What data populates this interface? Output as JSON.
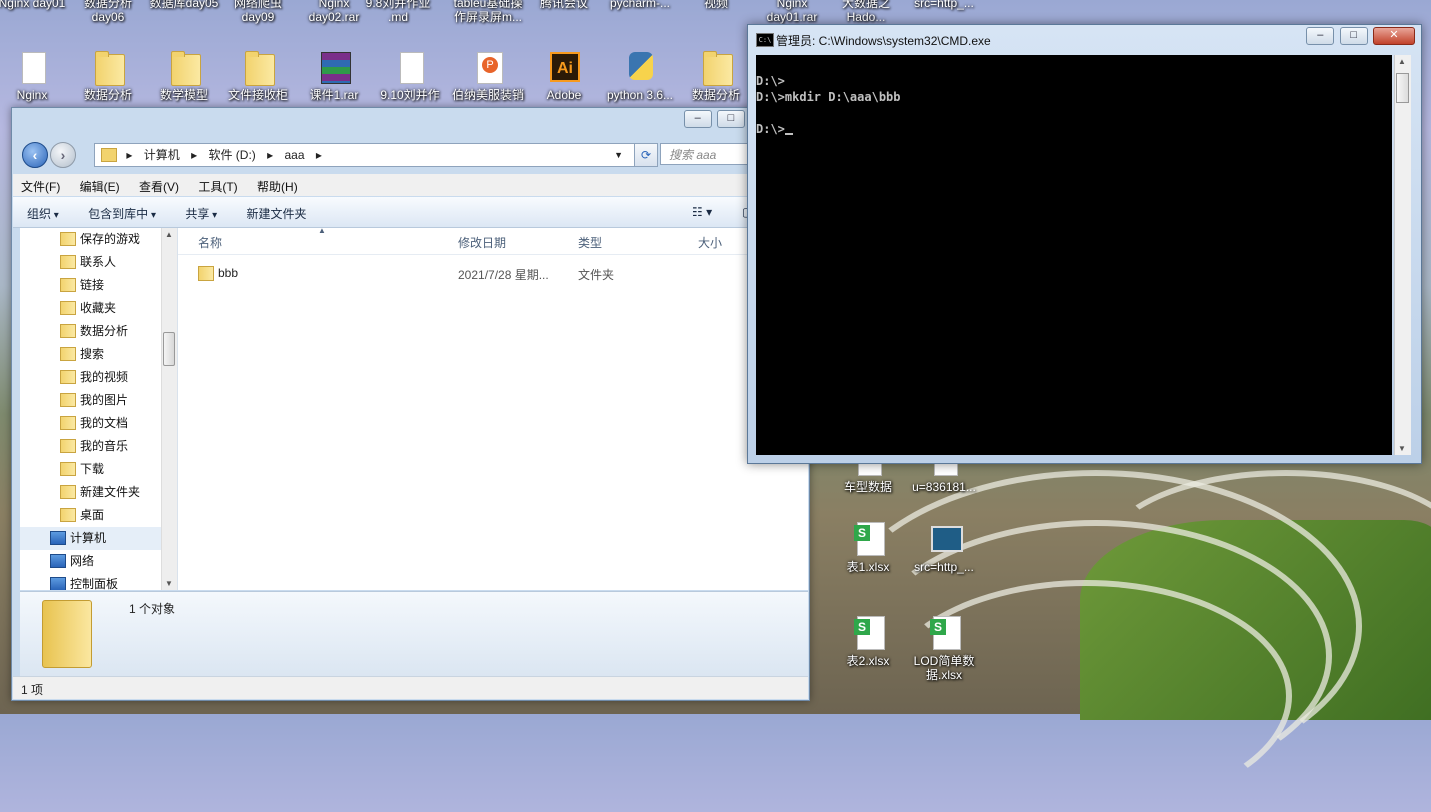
{
  "desktop": {
    "top_row_labels": [
      "Nginx day01",
      "数据分析 day06",
      "数据库day05",
      "网络爬虫 day09",
      "Nginx day02.rar",
      "9.8刘并作业 .md",
      "tableu基础操 作屏录屏m...",
      "腾讯会议",
      "pycharm-...",
      "视频",
      "Nginx day01.rar",
      "大数据之 Hado...",
      "src=http_..."
    ],
    "icons": [
      {
        "label": "Nginx",
        "icon": "shortcut-icon"
      },
      {
        "label": "数据分析",
        "icon": "folder-icon"
      },
      {
        "label": "数学模型",
        "icon": "folder-icon"
      },
      {
        "label": "文件接收柜",
        "icon": "folder-icon"
      },
      {
        "label": "课件1.rar",
        "icon": "rar-icon"
      },
      {
        "label": "9.10刘并作",
        "icon": "document-icon"
      },
      {
        "label": "伯纳美服装销",
        "icon": "ppt-icon"
      },
      {
        "label": "Adobe",
        "icon": "illustrator-icon"
      },
      {
        "label": "python 3.6...",
        "icon": "python-icon"
      },
      {
        "label": "数据分析",
        "icon": "folder-icon"
      },
      {
        "label": "车型数据",
        "icon": "file-icon"
      },
      {
        "label": "u=836181...",
        "icon": "image-icon"
      },
      {
        "label": "表1.xlsx",
        "icon": "xlsx-icon"
      },
      {
        "label": "src=http_...",
        "icon": "monitor-icon"
      },
      {
        "label": "表2.xlsx",
        "icon": "xlsx-icon"
      },
      {
        "label": "LOD简单数 据.xlsx",
        "icon": "xlsx-icon"
      }
    ]
  },
  "explorer": {
    "breadcrumb": [
      "计算机",
      "软件 (D:)",
      "aaa"
    ],
    "search_placeholder": "搜索 aaa",
    "menu": [
      "文件(F)",
      "编辑(E)",
      "查看(V)",
      "工具(T)",
      "帮助(H)"
    ],
    "toolbar": [
      "组织",
      "包含到库中",
      "共享",
      "新建文件夹"
    ],
    "nav_items": [
      {
        "label": "保存的游戏",
        "level": 2,
        "selected": false
      },
      {
        "label": "联系人",
        "level": 2,
        "selected": false
      },
      {
        "label": "链接",
        "level": 2,
        "selected": false
      },
      {
        "label": "收藏夹",
        "level": 2,
        "selected": false
      },
      {
        "label": "数据分析",
        "level": 2,
        "selected": false
      },
      {
        "label": "搜索",
        "level": 2,
        "selected": false
      },
      {
        "label": "我的视频",
        "level": 2,
        "selected": false
      },
      {
        "label": "我的图片",
        "level": 2,
        "selected": false
      },
      {
        "label": "我的文档",
        "level": 2,
        "selected": false
      },
      {
        "label": "我的音乐",
        "level": 2,
        "selected": false
      },
      {
        "label": "下载",
        "level": 2,
        "selected": false
      },
      {
        "label": "新建文件夹",
        "level": 2,
        "selected": false
      },
      {
        "label": "桌面",
        "level": 2,
        "selected": false
      },
      {
        "label": "计算机",
        "level": 1,
        "selected": true
      },
      {
        "label": "网络",
        "level": 1,
        "selected": false
      },
      {
        "label": "控制面板",
        "level": 1,
        "selected": false
      }
    ],
    "columns": [
      "名称",
      "修改日期",
      "类型",
      "大小"
    ],
    "files": [
      {
        "name": "bbb",
        "modified": "2021/7/28 星期...",
        "type": "文件夹",
        "size": ""
      }
    ],
    "details_text": "1 个对象",
    "status_text": "1 项"
  },
  "cmd": {
    "title": "管理员: C:\\Windows\\system32\\CMD.exe",
    "icon_label": "C:\\",
    "lines": [
      "D:\\>",
      "D:\\>mkdir D:\\aaa\\bbb",
      "",
      "D:\\>"
    ]
  }
}
